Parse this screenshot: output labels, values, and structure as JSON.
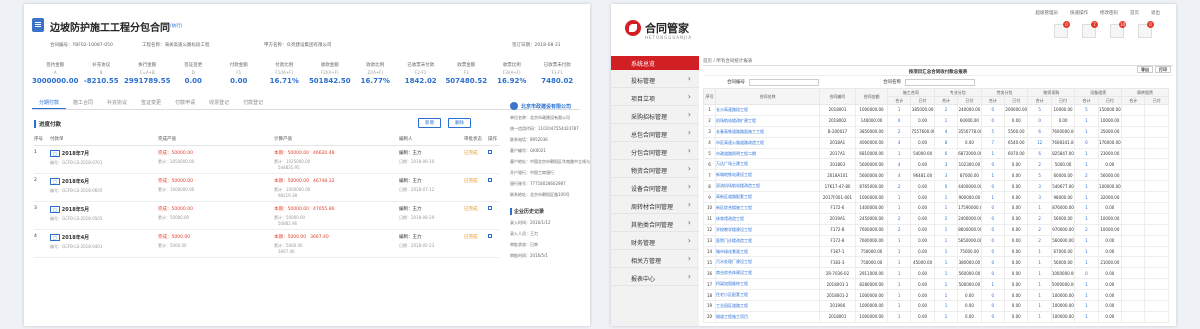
{
  "left": {
    "title": "边坡防护施工工程分包合同",
    "status": "(执行)",
    "meta": [
      "合同编号：YBF02-10087-050",
      "工程名称：海关高速公路标段工程",
      "甲方名称：众亮建设集团有限公司",
      "签订日期：2018-08-31"
    ],
    "stats": [
      {
        "label": "签约金额",
        "sub": "A",
        "value": "3000000.00"
      },
      {
        "label": "补充协议",
        "sub": "B",
        "value": "-8210.55"
      },
      {
        "label": "执行金额",
        "sub": "C=A+B",
        "value": "2991789.55"
      },
      {
        "label": "签证变更",
        "sub": "D",
        "value": "0.00"
      },
      {
        "label": "付款金额",
        "sub": "F1",
        "value": "0.00"
      },
      {
        "label": "付款比例",
        "sub": "F1/(A+F)",
        "value": "16.71%"
      },
      {
        "label": "收款金额",
        "sub": "F2/(A+F)",
        "value": "501842.50"
      },
      {
        "label": "收款比例",
        "sub": "Z/(A+F)",
        "value": "16.77%"
      },
      {
        "label": "已收票未付款",
        "sub": "F2-F1",
        "value": "1842.02"
      },
      {
        "label": "收票金额",
        "sub": "F3",
        "value": "507480.52"
      },
      {
        "label": "收票比例",
        "sub": "F3/(A+F)",
        "value": "16.92%"
      },
      {
        "label": "已收票未付款",
        "sub": "F3-F1",
        "value": "7480.02"
      }
    ],
    "tabs": [
      "分期付款",
      "施工合同",
      "补充协议",
      "签证变更",
      "付款申请",
      "收票登记",
      "付款登记"
    ],
    "plan_title": "进度付款",
    "btn_new": "新增",
    "btn_del": "删除",
    "headers": [
      "序号",
      "付款单",
      "完成产值",
      "计算产值",
      "编制人",
      "审批状态",
      "操作"
    ],
    "rows": [
      {
        "no": "1",
        "name": "2018年7月",
        "code": "编号：GCFB-LS-2018-0701",
        "done": "完成：50000.00",
        "done2": "累计：1054000.00",
        "calc": "本期：50000.00",
        "calc2": "累计：1025000.00",
        "calc_red": "46620.48",
        "calc_red2": "544835.95",
        "author": "编制：王力",
        "date": "日期：2018-06-10",
        "state": "已完成"
      },
      {
        "no": "2",
        "name": "2018年6月",
        "code": "编号：GCFB-LS-2018-0605",
        "done": "完成：50000.00",
        "done2": "累计：1000000.00",
        "calc": "本期：50000.00",
        "calc2": "累计：1000000.00",
        "calc_red": "46748.32",
        "calc_red2": "98219.38",
        "author": "编制：王力",
        "date": "日期：2018-07-12",
        "state": "已完成"
      },
      {
        "no": "3",
        "name": "2018年5月",
        "code": "编号：GCFB-LS-2018-0505",
        "done": "完成：50000.00",
        "done2": "累计：50000.00",
        "calc": "本期：50000.00",
        "calc2": "累计：50000.00",
        "calc_red": "47055.86",
        "calc_red2": "50882.96",
        "author": "编制：王力",
        "date": "日期：2018-08-29",
        "state": "已完成"
      },
      {
        "no": "4",
        "name": "2018年4月",
        "code": "编号：GCFB-LS-2018-0401",
        "done": "完成：5000.00",
        "done2": "累计：5000.00",
        "calc": "本期：5000.00",
        "calc2": "累计：5000.00",
        "calc_red": "3667.40",
        "calc_red2": "3667.40",
        "author": "编制：王力",
        "date": "日期：2018-05-23",
        "state": "已完成"
      }
    ],
    "info": {
      "org": "北京市政建设有限公司",
      "lines": [
        "单位名称：北京市政建设有限公司",
        "统一信用代码：1101047554424787",
        "联系电话：8952036",
        "客户编号：GK0021",
        "客户地址：中国北京市朝阳区华南路中立线与",
        "开户银行：中国工商银行",
        "银行账号：77718028602987",
        "联系地址：北京市朝阳区路100号"
      ],
      "sec2": "企业历史记录",
      "lines2": [
        "录入时间：2016/1/12",
        "录入人员：王力",
        "审批状态：已审",
        "审批时间：2016/5/1"
      ]
    }
  },
  "right": {
    "logo": "合同管家",
    "logo_sub": "HETONGGUANJIA",
    "topbar": [
      "超级管理员",
      "快速操作",
      "修改密码",
      "首页",
      "退出"
    ],
    "badges": [
      "0",
      "7",
      "10",
      "0"
    ],
    "side_title": "系统总览",
    "side": [
      "投标管理",
      "项目立项",
      "采购招标管理",
      "总包合同管理",
      "分包合同管理",
      "物资合同管理",
      "设备合同管理",
      "周转材合同管理",
      "其他类合同管理",
      "财务管理",
      "相关方管理",
      "报表中心"
    ],
    "crumb": "首页 / 所有合同统计报表",
    "report_title": "按项目汇总合同收付款总报表",
    "btns": [
      "导出",
      "打印"
    ],
    "search_labels": [
      "合同编号",
      "合同名称"
    ],
    "headers": [
      "序号",
      "合同名称",
      "合同编号",
      "合同金额",
      "施工合同",
      "",
      "专业分包",
      "",
      "劳务分包",
      "",
      "物资采购",
      "",
      "设备租赁",
      "",
      "周转租赁",
      ""
    ],
    "subheaders": [
      "合计",
      "已付",
      "合计",
      "已付",
      "合计",
      "已付",
      "合计",
      "已付",
      "合计",
      "已付",
      "合计",
      "已付"
    ],
    "rows": [
      [
        "1",
        "长沙高速路段工程",
        "2018001",
        "1000000.00",
        "1",
        "385000.00",
        "2",
        "240000.00",
        "0",
        "200000.00",
        "5",
        "10000.00",
        "5",
        "150000.00"
      ],
      [
        "2",
        "机场航站楼改扩建工程",
        "2018002",
        "140000.00",
        "0",
        "0.00",
        "1",
        "60000.00",
        "0",
        "0.00",
        "0",
        "0.00",
        "1",
        "10000.00"
      ],
      [
        "3",
        "长春高铁道路路面施工工程",
        "B-200017",
        "3850000.00",
        "2",
        "7557600.00",
        "4",
        "3556778.00",
        "5",
        "5500.00",
        "6",
        "7600000.00",
        "1",
        "35000.00"
      ],
      [
        "4",
        "市区高速公路道路改造工程",
        "2018A1",
        "4000000.00",
        "4",
        "0.00",
        "8",
        "0.00",
        "7",
        "6540.00",
        "12",
        "7608341.00",
        "0",
        "176000.00"
      ],
      [
        "5",
        "市政道路照明工程二期",
        "2017A1",
        "6810000.00",
        "1",
        "54000.00",
        "6",
        "6872000.00",
        "1",
        "6070.00",
        "6",
        "825847.00",
        "1",
        "23000.00"
      ],
      [
        "6",
        "万达广场土建工程",
        "201803",
        "5600000.00",
        "4",
        "0.00",
        "3",
        "102300.00",
        "0",
        "0.00",
        "2",
        "5000.00",
        "1",
        "0.00"
      ],
      [
        "7",
        "新城地铁站建设工程",
        "2018A101",
        "5600000.00",
        "4",
        "96481.00",
        "3",
        "87000.00",
        "1",
        "0.00",
        "5",
        "60000.00",
        "2",
        "56000.00"
      ],
      [
        "8",
        "双流机场航站楼改造工程",
        "17K17-47-80",
        "8765000.00",
        "2",
        "0.00",
        "0",
        "4400000.00",
        "0",
        "0.00",
        "3",
        "540677.00",
        "1",
        "100000.00"
      ],
      [
        "9",
        "高新区道路配套工程",
        "2017F001-001",
        "1000000.00",
        "1",
        "0.00",
        "1",
        "900000.00",
        "1",
        "0.00",
        "3",
        "98000.00",
        "1",
        "32000.00"
      ],
      [
        "10",
        "新区综合楼施工工程",
        "F172-6",
        "1400000.00",
        "1",
        "0.00",
        "1",
        "17590000.00",
        "0",
        "0.00",
        "1",
        "876000.00",
        "1",
        "0.00"
      ],
      [
        "11",
        "体育馆改造工程",
        "2019A1",
        "2450000.00",
        "2",
        "0.00",
        "2",
        "2400000.00",
        "0",
        "0.00",
        "2",
        "56000.00",
        "1",
        "10000.00"
      ],
      [
        "12",
        "学校教学楼建设工程",
        "F172-8",
        "7600000.00",
        "2",
        "0.00",
        "1",
        "8600000.00",
        "0",
        "0.00",
        "2",
        "970000.00",
        "2",
        "10000.00"
      ],
      [
        "13",
        "医院门诊楼改造工程",
        "F172-8",
        "7600000.00",
        "1",
        "0.00",
        "1",
        "5650000.00",
        "0",
        "0.00",
        "2",
        "560000.00",
        "1",
        "0.00"
      ],
      [
        "14",
        "城市绿化景观工程",
        "F187-1",
        "750000.00",
        "1",
        "0.00",
        "1",
        "75000.00",
        "0",
        "0.00",
        "1",
        "67000.00",
        "1",
        "0.00"
      ],
      [
        "15",
        "污水处理厂建设工程",
        "F183-3",
        "750000.00",
        "1",
        "45000.00",
        "1",
        "380000.00",
        "0",
        "0.00",
        "1",
        "56000.00",
        "1",
        "21000.00"
      ],
      [
        "16",
        "商业综合体建设工程",
        "2R-7036-02",
        "2911000.00",
        "1",
        "0.00",
        "1",
        "560000.00",
        "0",
        "0.00",
        "1",
        "1000000.00",
        "0",
        "0.00"
      ],
      [
        "17",
        "桥梁加固维修工程",
        "2018001-1",
        "8280000.00",
        "1",
        "0.00",
        "1",
        "500000.00",
        "1",
        "0.00",
        "1",
        "5000000.00",
        "1",
        "0.00"
      ],
      [
        "18",
        "住宅小区配套工程",
        "2018001-2",
        "1000000.00",
        "1",
        "0.00",
        "1",
        "0.00",
        "0",
        "0.00",
        "1",
        "100000.00",
        "1",
        "0.00"
      ],
      [
        "19",
        "工业园区道路工程",
        "201906",
        "1000000.00",
        "1",
        "0.00",
        "1",
        "0.00",
        "0",
        "0.00",
        "1",
        "100000.00",
        "1",
        "0.00"
      ],
      [
        "20",
        "隧道工程施工项目",
        "2018001",
        "1000000.00",
        "1",
        "0.00",
        "1",
        "0.00",
        "0",
        "0.00",
        "1",
        "100000.00",
        "1",
        "0.00"
      ]
    ]
  }
}
